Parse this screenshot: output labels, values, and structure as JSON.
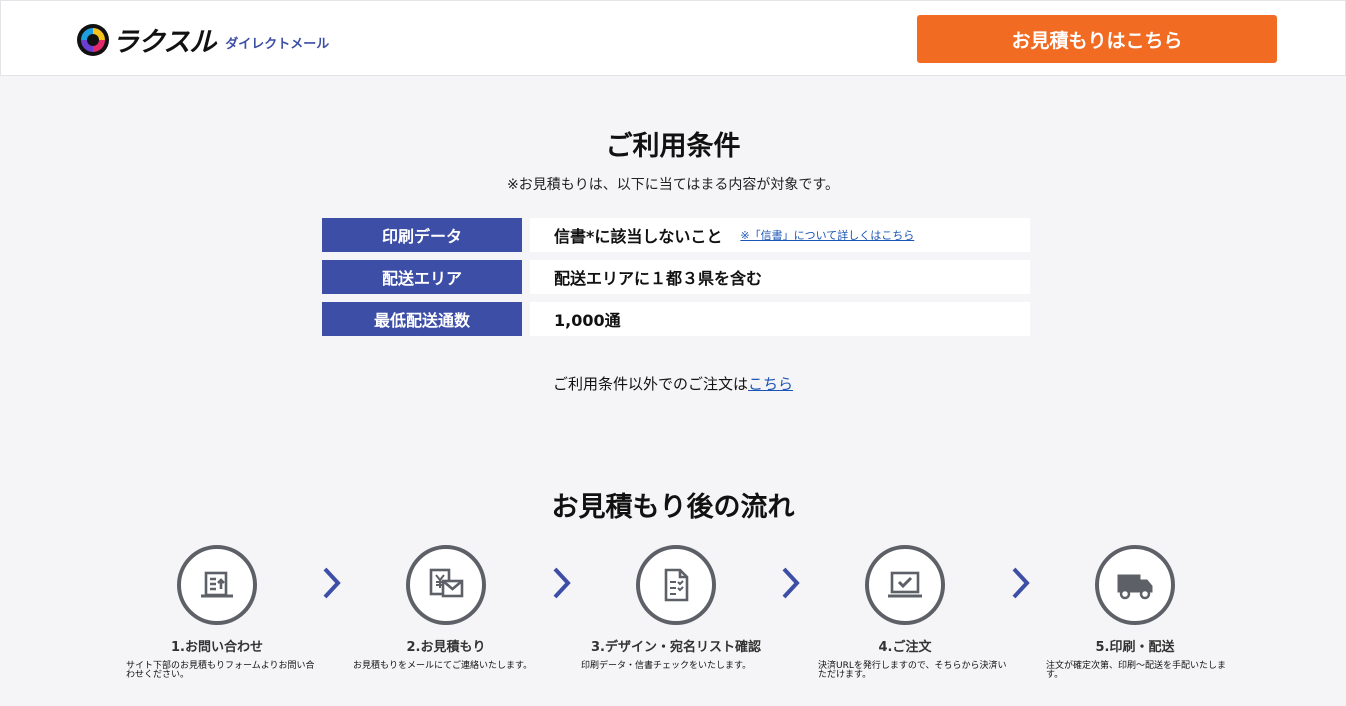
{
  "header": {
    "logo_text": "ラクスル",
    "logo_sub": "ダイレクトメール",
    "quote_button": "お見積もりはこちら"
  },
  "conditions": {
    "title": "ご利用条件",
    "note": "※お見積もりは、以下に当てはまる内容が対象です。",
    "rows": [
      {
        "label": "印刷データ",
        "value": "信書*に該当しないこと",
        "link": "※「信書」について詳しくはこちら"
      },
      {
        "label": "配送エリア",
        "value": "配送エリアに１都３県を含む"
      },
      {
        "label": "最低配送通数",
        "value": "1,000通"
      }
    ],
    "other_text": "ご利用条件以外でのご注文は",
    "other_link": "こちら"
  },
  "flow": {
    "title": "お見積もり後の流れ",
    "steps": [
      {
        "icon": "document-upload-icon",
        "title": "1.お問い合わせ",
        "desc": "サイト下部のお見積もりフォームよりお問い合わせください。"
      },
      {
        "icon": "yen-mail-icon",
        "title": "2.お見積もり",
        "desc": "お見積もりをメールにてご連絡いたします。"
      },
      {
        "icon": "checklist-document-icon",
        "title": "3.デザイン・宛名リスト確認",
        "desc": "印刷データ・信書チェックをいたします。"
      },
      {
        "icon": "laptop-check-icon",
        "title": "4.ご注文",
        "desc": "決済URLを発行しますので、そちらから決済いただけます。"
      },
      {
        "icon": "truck-icon",
        "title": "5.印刷・配送",
        "desc": "注文が確定次第、印刷〜配送を手配いたします。"
      }
    ]
  },
  "colors": {
    "accent": "#f26b22",
    "brand_blue": "#3d4ea6",
    "icon_gray": "#5e6068",
    "link": "#1a55b5"
  }
}
